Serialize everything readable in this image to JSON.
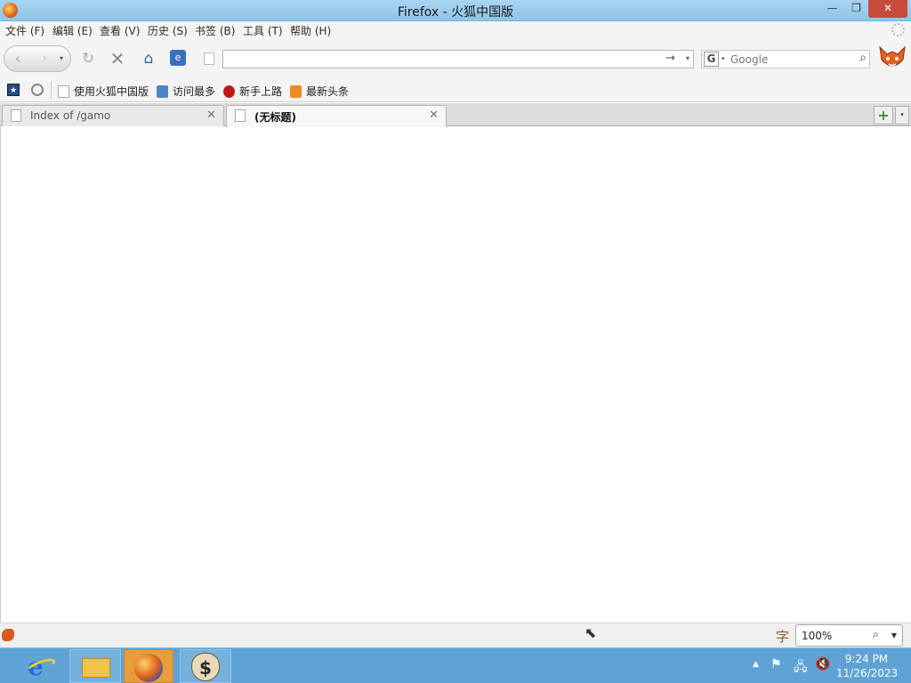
{
  "window": {
    "title": "Firefox - 火狐中国版",
    "min_label": "—",
    "max_label": "❐",
    "close_label": "✕"
  },
  "menu": {
    "items": [
      "文件 (F)",
      "编辑 (E)",
      "查看 (V)",
      "历史 (S)",
      "书签 (B)",
      "工具 (T)",
      "帮助 (H)"
    ]
  },
  "navbar": {
    "back_glyph": "‹",
    "forward_glyph": "›",
    "reload_glyph": "↻",
    "stop_glyph": "✕",
    "home_glyph": "⌂",
    "url_value": "",
    "go_glyph": "→",
    "search_engine_letter": "G",
    "search_placeholder": "Google"
  },
  "bookmarks": {
    "items": [
      {
        "label": "使用火狐中国版",
        "icon": "page-icon"
      },
      {
        "label": "访问最多",
        "icon": "most-visited-icon"
      },
      {
        "label": "新手上路",
        "icon": "firefox-cn-icon"
      },
      {
        "label": "最新头条",
        "icon": "rss-feed-icon"
      }
    ]
  },
  "tabs": [
    {
      "label": "Index of /gamo",
      "active": false
    },
    {
      "label": "(无标题)",
      "active": true
    }
  ],
  "tab_controls": {
    "new_tab": "+",
    "list": "▾"
  },
  "statusbar": {
    "font_glyph": "字",
    "zoom_value": "100%"
  },
  "taskbar": {
    "clock_time": "9:24 PM",
    "clock_date": "11/26/2023",
    "money_glyph": "$"
  },
  "colors": {
    "titlebar": "#8fc3e8",
    "taskbar": "#5fa3d6",
    "close_button": "#c84c3c",
    "new_tab_plus": "#3a9a2a"
  }
}
